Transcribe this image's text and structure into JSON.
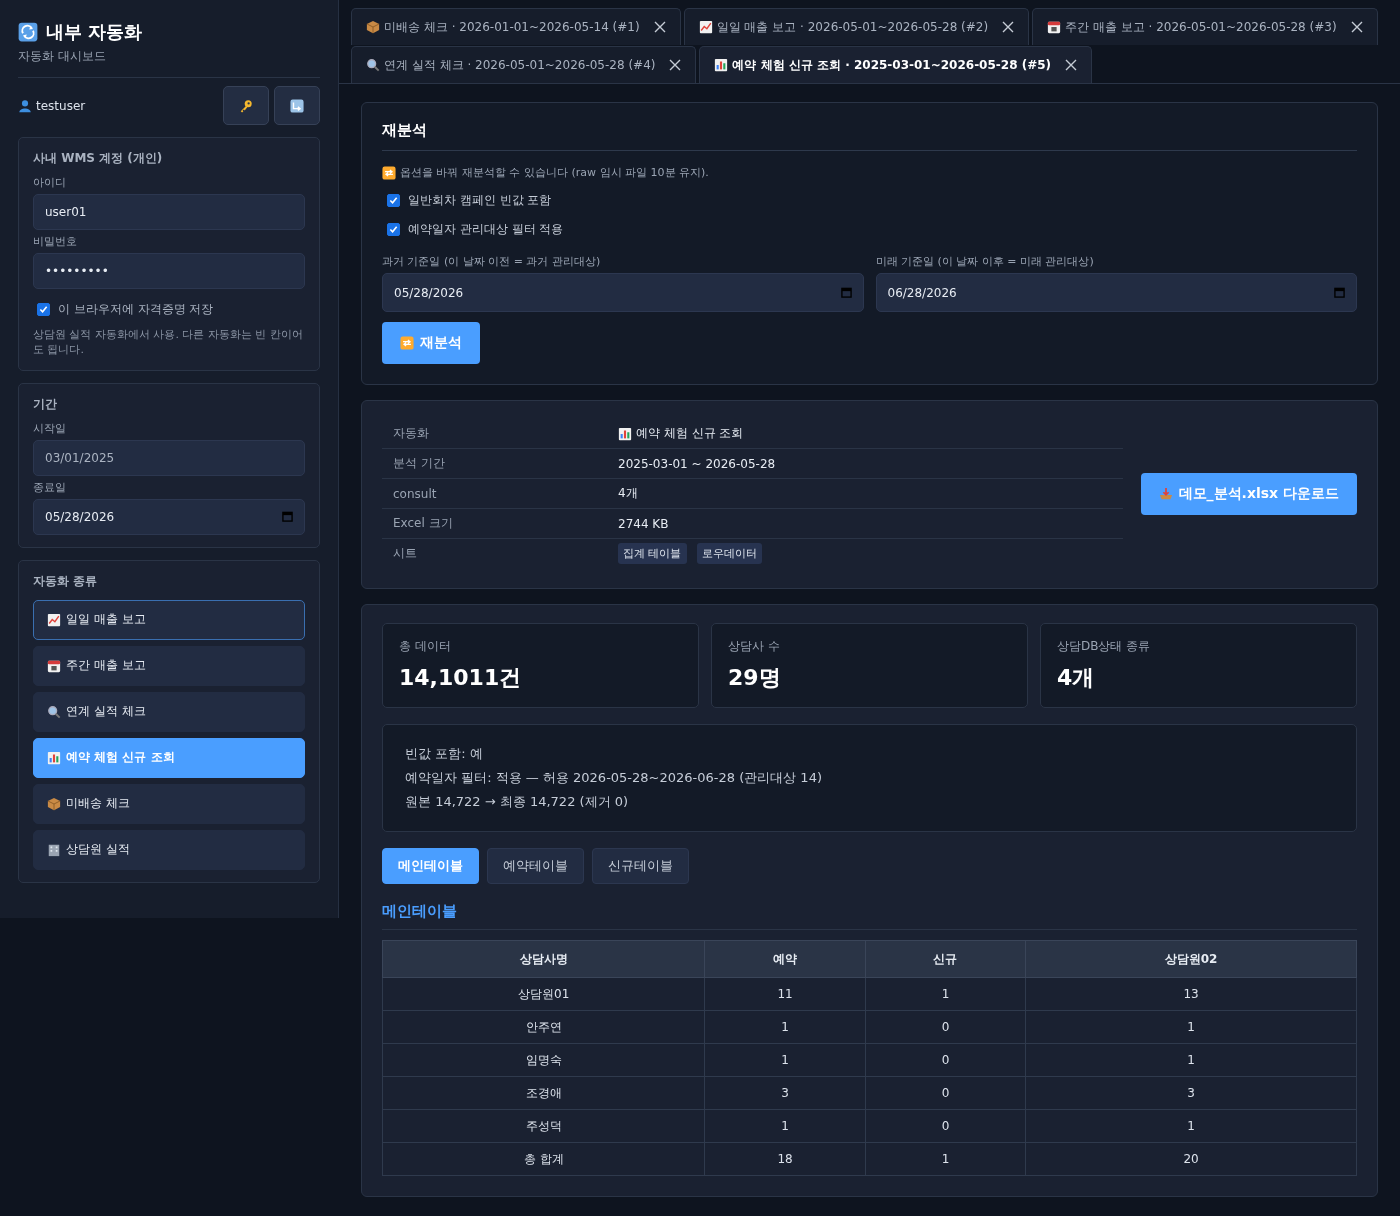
{
  "sidebar": {
    "title": "내부 자동화",
    "subtitle": "자동화 대시보드",
    "user": "testuser",
    "account": {
      "heading": "사내 WMS 계정 (개인)",
      "id_label": "아이디",
      "id_value": "user01",
      "password_label": "비밀번호",
      "password_value": "•••••••••",
      "remember": {
        "label": "이 브라우저에 자격증명 저장",
        "checked": true
      },
      "note": "상담원 실적 자동화에서 사용. 다른 자동화는 빈 칸이어도 됩니다."
    },
    "period": {
      "heading": "기간",
      "start_label": "시작일",
      "start_value": "03/01/2025",
      "end_label": "종료일",
      "end_value": "05/28/2026"
    },
    "automations": {
      "heading": "자동화 종류",
      "items": [
        {
          "kind": "chart-up",
          "label": "일일 매출 보고",
          "selected": false,
          "focused": true
        },
        {
          "kind": "calendar",
          "label": "주간 매출 보고",
          "selected": false,
          "focused": false
        },
        {
          "kind": "search",
          "label": "연계 실적 체크",
          "selected": false,
          "focused": false
        },
        {
          "kind": "bar-chart",
          "label": "예약 체험 신규 조회",
          "selected": true,
          "focused": false
        },
        {
          "kind": "box",
          "label": "미배송 체크",
          "selected": false,
          "focused": false
        },
        {
          "kind": "building",
          "label": "상담원 실적",
          "selected": false,
          "focused": false
        }
      ]
    }
  },
  "tabs": [
    [
      {
        "kind": "box",
        "label": "미배송 체크 · 2026-01-01~2026-05-14 (#1)",
        "selected": false
      },
      {
        "kind": "chart-up",
        "label": "일일 매출 보고 · 2026-05-01~2026-05-28 (#2)",
        "selected": false
      },
      {
        "kind": "calendar",
        "label": "주간 매출 보고 · 2026-05-01~2026-05-28 (#3)",
        "selected": false
      }
    ],
    [
      {
        "kind": "search",
        "label": "연계 실적 체크 · 2026-05-01~2026-05-28 (#4)",
        "selected": false
      },
      {
        "kind": "bar-chart",
        "label": "예약 체험 신규 조회 · 2025-03-01~2026-05-28 (#5)",
        "selected": true
      }
    ]
  ],
  "reanalysis": {
    "title": "재분석",
    "note": "옵션을 바꿔 재분석할 수 있습니다 (raw 임시 파일 10분 유지).",
    "options": [
      {
        "label": "일반회차 캠페인 빈값 포함",
        "checked": true
      },
      {
        "label": "예약일자 관리대상 필터 적용",
        "checked": true
      }
    ],
    "dates": [
      {
        "label": "과거 기준일 (이 날짜 이전 = 과거 관리대상)",
        "value": "05/28/2026"
      },
      {
        "label": "미래 기준일 (이 날짜 이후 = 미래 관리대상)",
        "value": "06/28/2026"
      }
    ],
    "button": "재분석"
  },
  "info": {
    "rows": [
      {
        "kind": "automation",
        "label": "자동화",
        "value": "예약 체험 신규 조회"
      },
      {
        "kind": "text",
        "label": "분석 기간",
        "value": "2025-03-01 ~ 2026-05-28"
      },
      {
        "kind": "text",
        "label": "consult",
        "value": "4개"
      },
      {
        "kind": "text",
        "label": "Excel 크기",
        "value": "2744 KB"
      },
      {
        "kind": "tags",
        "label": "시트",
        "tags": [
          "집계 테이블",
          "로우데이터"
        ]
      }
    ],
    "download": "데모_분석.xlsx 다운로드"
  },
  "stats": [
    {
      "label": "총 데이터",
      "value": "14,1011건"
    },
    {
      "label": "상담사 수",
      "value": "29명"
    },
    {
      "label": "상담DB상태 종류",
      "value": "4개"
    }
  ],
  "summary": [
    "빈값 포함: 예",
    "예약일자 필터: 적용 — 허용 2026-05-28~2026-06-28 (관리대상 14)",
    "원본 14,722 → 최종 14,722 (제거 0)"
  ],
  "table_tabs": [
    {
      "label": "메인테이블",
      "selected": true
    },
    {
      "label": "예약테이블",
      "selected": false
    },
    {
      "label": "신규테이블",
      "selected": false
    }
  ],
  "section_title": "메인테이블",
  "table": {
    "columns": [
      "상담사명",
      "예약",
      "신규",
      "상담원02"
    ],
    "rows": [
      [
        "상담원01",
        "11",
        "1",
        "13"
      ],
      [
        "안주연",
        "1",
        "0",
        "1"
      ],
      [
        "임명숙",
        "1",
        "0",
        "1"
      ],
      [
        "조경애",
        "3",
        "0",
        "3"
      ],
      [
        "주성덕",
        "1",
        "0",
        "1"
      ],
      [
        "총 합계",
        "18",
        "1",
        "20"
      ]
    ]
  }
}
